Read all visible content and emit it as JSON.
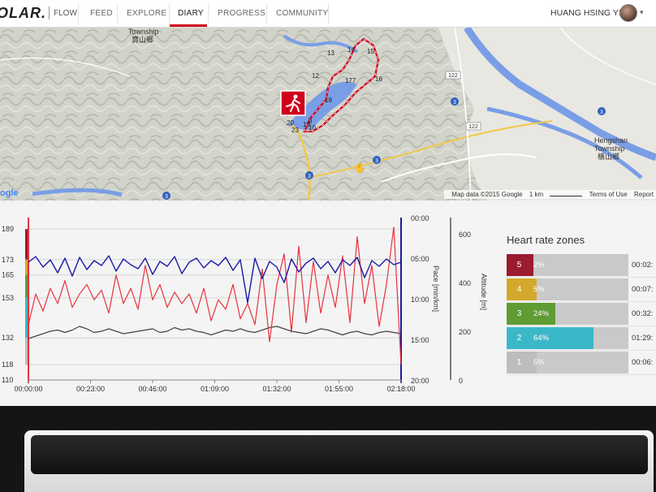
{
  "nav": {
    "logo": "OLAR.",
    "brand": "FLOW",
    "items": [
      "FEED",
      "EXPLORE",
      "DIARY",
      "PROGRESS",
      "COMMUNITY"
    ],
    "active": "DIARY",
    "user": "HUANG HSING YI",
    "caret": "▾"
  },
  "map": {
    "labels": {
      "township_top": "Township",
      "township_top_local": "寶山鄉",
      "hengshan": "Hengshan",
      "hengshan2": "Township",
      "hengshan_local": "橫山鄉",
      "road_122a": "122",
      "road_122b": "122",
      "road_3a": "3",
      "road_3b": "3",
      "road_3c": "3",
      "road_3d": "3",
      "road_3e": "3"
    },
    "route_markers": [
      "13",
      "14",
      "15",
      "16",
      "12",
      "177",
      "18",
      "9",
      "10",
      "20",
      "23",
      "19"
    ],
    "google": "ogle",
    "credits": {
      "data": "Map data ©2015 Google",
      "scale": "1 km",
      "terms": "Terms of Use",
      "report": "Report"
    },
    "sport_icon": "running-icon"
  },
  "colors": {
    "hr": "#e8323c",
    "pace": "#1a1aa6",
    "altitude": "#444444",
    "z5": "#9b1b30",
    "z4": "#d4a82c",
    "z3": "#5f9c34",
    "z2": "#3bb8c8",
    "z1": "#bdbdbd"
  },
  "chart_data": {
    "type": "line",
    "x_ticks": [
      "00:00:00",
      "00:23:00",
      "00:46:00",
      "01:09:00",
      "01:32:00",
      "01:55:00",
      "02:18:00"
    ],
    "hr_ticks": [
      "189",
      "173",
      "165",
      "153",
      "132",
      "118",
      "110"
    ],
    "pace_ticks": [
      "00:00",
      "05:00",
      "10:00",
      "15:00",
      "20:00"
    ],
    "pace_label": "Pace [min/km]",
    "alt_ticks": [
      "600",
      "400",
      "200",
      "0"
    ],
    "alt_label": "Altitude [m]",
    "series": [
      {
        "name": "Heart rate",
        "unit": "bpm",
        "values": [
          139,
          155,
          146,
          158,
          150,
          162,
          148,
          155,
          160,
          152,
          157,
          145,
          165,
          150,
          158,
          147,
          170,
          152,
          160,
          148,
          156,
          150,
          155,
          145,
          158,
          141,
          152,
          147,
          160,
          142,
          150,
          139,
          168,
          130,
          160,
          176,
          135,
          180,
          140,
          172,
          145,
          165,
          148,
          175,
          140,
          185,
          150,
          170,
          138,
          160,
          190,
          118
        ]
      },
      {
        "name": "Pace",
        "unit": "min/km",
        "values": [
          5.5,
          4.8,
          6.1,
          5.2,
          6.8,
          5.0,
          7.2,
          4.9,
          6.4,
          5.3,
          5.9,
          4.7,
          6.6,
          5.1,
          5.8,
          6.3,
          5.0,
          7.0,
          5.4,
          6.0,
          4.8,
          6.9,
          5.5,
          5.0,
          6.2,
          5.3,
          5.9,
          4.9,
          6.5,
          5.2,
          10.5,
          5.0,
          7.5,
          5.4,
          6.1,
          8.0,
          5.1,
          6.7,
          5.6,
          5.0,
          6.3,
          5.4,
          6.8,
          5.2,
          5.9,
          4.9,
          7.4,
          5.3,
          6.0,
          5.1,
          5.8,
          5.5
        ]
      },
      {
        "name": "Altitude",
        "unit": "m",
        "values": [
          170,
          180,
          190,
          200,
          205,
          195,
          205,
          220,
          210,
          195,
          200,
          210,
          200,
          190,
          195,
          200,
          205,
          210,
          195,
          200,
          215,
          205,
          210,
          200,
          195,
          185,
          195,
          205,
          200,
          210,
          200,
          195,
          205,
          215,
          220,
          210,
          200,
          195,
          190,
          200,
          210,
          205,
          195,
          185,
          195,
          200,
          190,
          185,
          195,
          200,
          195,
          190
        ]
      }
    ]
  },
  "hr_zones": {
    "title": "Heart rate zones",
    "zones": [
      {
        "zone": "5",
        "pct": "2%",
        "frac": 0.02,
        "time": "00:02:"
      },
      {
        "zone": "4",
        "pct": "5%",
        "frac": 0.05,
        "time": "00:07:"
      },
      {
        "zone": "3",
        "pct": "24%",
        "frac": 0.24,
        "time": "00:32:"
      },
      {
        "zone": "2",
        "pct": "64%",
        "frac": 0.64,
        "time": "01:29:"
      },
      {
        "zone": "1",
        "pct": "5%",
        "frac": 0.05,
        "time": "00:06:"
      }
    ]
  }
}
